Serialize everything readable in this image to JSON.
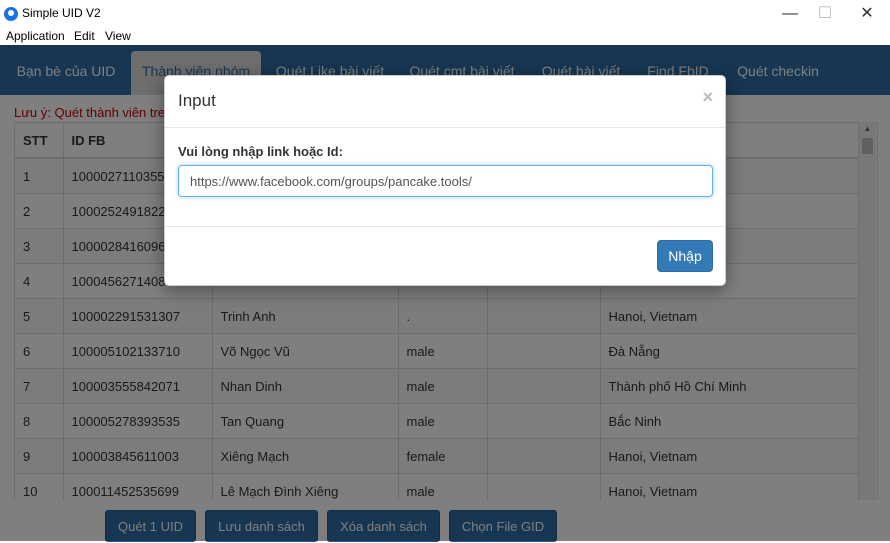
{
  "window": {
    "title": "Simple UID V2",
    "minimize": "—",
    "maximize": "☐",
    "close": "✕"
  },
  "menu": [
    "Application",
    "Edit",
    "View"
  ],
  "tabs": [
    "Bạn bè của UID",
    "Thành viên nhóm",
    "Quét Like bài viết",
    "Quét cmt bài viết",
    "Quét bài viết",
    "Find FbID",
    "Quét checkin"
  ],
  "note": "Lưu ý: Quét thành viên tre",
  "table": {
    "headers": [
      "STT",
      "ID FB",
      "",
      "",
      "",
      ""
    ],
    "rows": [
      [
        "1",
        "1000027110355",
        "",
        "",
        "",
        ""
      ],
      [
        "2",
        "1000252491822",
        "",
        "",
        "",
        ""
      ],
      [
        "3",
        "1000028416096",
        "",
        "",
        "",
        ""
      ],
      [
        "4",
        "1000456271408",
        "",
        "",
        "",
        ""
      ],
      [
        "5",
        "100002291531307",
        "Trinh Anh",
        ".",
        "",
        "Hanoi, Vietnam"
      ],
      [
        "6",
        "100005102133710",
        "Võ Ngọc Vũ",
        "male",
        "",
        "Đà Nẵng"
      ],
      [
        "7",
        "100003555842071",
        "Nhan Dinh",
        "male",
        "",
        "Thành phố Hồ Chí Minh"
      ],
      [
        "8",
        "100005278393535",
        "Tan Quang",
        "male",
        "",
        "Bắc Ninh"
      ],
      [
        "9",
        "100003845611003",
        "Xiêng Mạch",
        "female",
        "",
        "Hanoi, Vietnam"
      ],
      [
        "10",
        "100011452535699",
        "Lê Mạch Đình Xiêng",
        "male",
        "",
        "Hanoi, Vietnam"
      ]
    ]
  },
  "buttons": {
    "scan": "Quét 1 UID",
    "save": "Lưu danh sách",
    "clear": "Xóa danh sách",
    "choose_file": "Chọn File GID"
  },
  "modal": {
    "title": "Input",
    "close": "×",
    "label": "Vui lòng nhập link hoặc Id:",
    "input_value": "https://www.facebook.com/groups/pancake.tools/",
    "submit": "Nhập"
  }
}
